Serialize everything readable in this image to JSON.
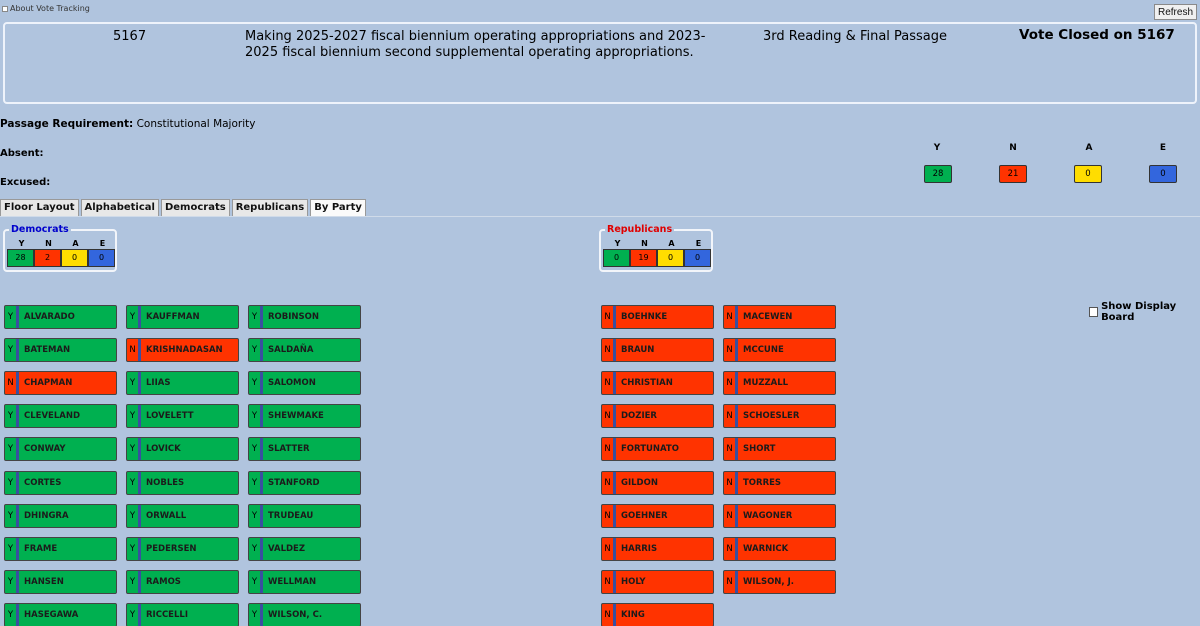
{
  "header": {
    "about_label": "About Vote Tracking",
    "refresh_label": "Refresh"
  },
  "bill": {
    "number": "5167",
    "title": "Making 2025-2027 fiscal biennium operating appropriations and 2023-2025 fiscal biennium second supplemental operating appropriations.",
    "stage": "3rd Reading & Final Passage",
    "status": "Vote Closed on 5167"
  },
  "passage": {
    "label": "Passage Requirement:",
    "value": "Constitutional Majority"
  },
  "absent_label": "Absent:",
  "excused_label": "Excused:",
  "totals": {
    "y_label": "Y",
    "n_label": "N",
    "a_label": "A",
    "e_label": "E",
    "y": "28",
    "n": "21",
    "a": "0",
    "e": "0"
  },
  "tabs": [
    "Floor Layout",
    "Alphabetical",
    "Democrats",
    "Republicans",
    "By Party"
  ],
  "active_tab": "By Party",
  "colors": {
    "yea": "#00b050",
    "nay": "#ff3300",
    "absent": "#ffdd00",
    "excused": "#3366dd",
    "democrats": "#0000cc",
    "republicans": "#e00000"
  },
  "democrats": {
    "name": "Democrats",
    "heads": [
      "Y",
      "N",
      "A",
      "E"
    ],
    "counts": [
      "28",
      "2",
      "0",
      "0"
    ]
  },
  "republicans": {
    "name": "Republicans",
    "heads": [
      "Y",
      "N",
      "A",
      "E"
    ],
    "counts": [
      "0",
      "19",
      "0",
      "0"
    ]
  },
  "show_display_board_label": "Show Display Board",
  "dem_members": [
    [
      {
        "v": "Y",
        "n": "ALVARADO"
      },
      {
        "v": "Y",
        "n": "BATEMAN"
      },
      {
        "v": "N",
        "n": "CHAPMAN"
      },
      {
        "v": "Y",
        "n": "CLEVELAND"
      },
      {
        "v": "Y",
        "n": "CONWAY"
      },
      {
        "v": "Y",
        "n": "CORTES"
      },
      {
        "v": "Y",
        "n": "DHINGRA"
      },
      {
        "v": "Y",
        "n": "FRAME"
      },
      {
        "v": "Y",
        "n": "HANSEN"
      },
      {
        "v": "Y",
        "n": "HASEGAWA"
      }
    ],
    [
      {
        "v": "Y",
        "n": "KAUFFMAN"
      },
      {
        "v": "N",
        "n": "KRISHNADASAN"
      },
      {
        "v": "Y",
        "n": "LIIAS"
      },
      {
        "v": "Y",
        "n": "LOVELETT"
      },
      {
        "v": "Y",
        "n": "LOVICK"
      },
      {
        "v": "Y",
        "n": "NOBLES"
      },
      {
        "v": "Y",
        "n": "ORWALL"
      },
      {
        "v": "Y",
        "n": "PEDERSEN"
      },
      {
        "v": "Y",
        "n": "RAMOS"
      },
      {
        "v": "Y",
        "n": "RICCELLI"
      }
    ],
    [
      {
        "v": "Y",
        "n": "ROBINSON"
      },
      {
        "v": "Y",
        "n": "SALDAÑA"
      },
      {
        "v": "Y",
        "n": "SALOMON"
      },
      {
        "v": "Y",
        "n": "SHEWMAKE"
      },
      {
        "v": "Y",
        "n": "SLATTER"
      },
      {
        "v": "Y",
        "n": "STANFORD"
      },
      {
        "v": "Y",
        "n": "TRUDEAU"
      },
      {
        "v": "Y",
        "n": "VALDEZ"
      },
      {
        "v": "Y",
        "n": "WELLMAN"
      },
      {
        "v": "Y",
        "n": "WILSON, C."
      }
    ]
  ],
  "rep_members": [
    [
      {
        "v": "N",
        "n": "BOEHNKE"
      },
      {
        "v": "N",
        "n": "BRAUN"
      },
      {
        "v": "N",
        "n": "CHRISTIAN"
      },
      {
        "v": "N",
        "n": "DOZIER"
      },
      {
        "v": "N",
        "n": "FORTUNATO"
      },
      {
        "v": "N",
        "n": "GILDON"
      },
      {
        "v": "N",
        "n": "GOEHNER"
      },
      {
        "v": "N",
        "n": "HARRIS"
      },
      {
        "v": "N",
        "n": "HOLY"
      },
      {
        "v": "N",
        "n": "KING"
      }
    ],
    [
      {
        "v": "N",
        "n": "MACEWEN"
      },
      {
        "v": "N",
        "n": "MCCUNE"
      },
      {
        "v": "N",
        "n": "MUZZALL"
      },
      {
        "v": "N",
        "n": "SCHOESLER"
      },
      {
        "v": "N",
        "n": "SHORT"
      },
      {
        "v": "N",
        "n": "TORRES"
      },
      {
        "v": "N",
        "n": "WAGONER"
      },
      {
        "v": "N",
        "n": "WARNICK"
      },
      {
        "v": "N",
        "n": "WILSON, J."
      }
    ]
  ]
}
